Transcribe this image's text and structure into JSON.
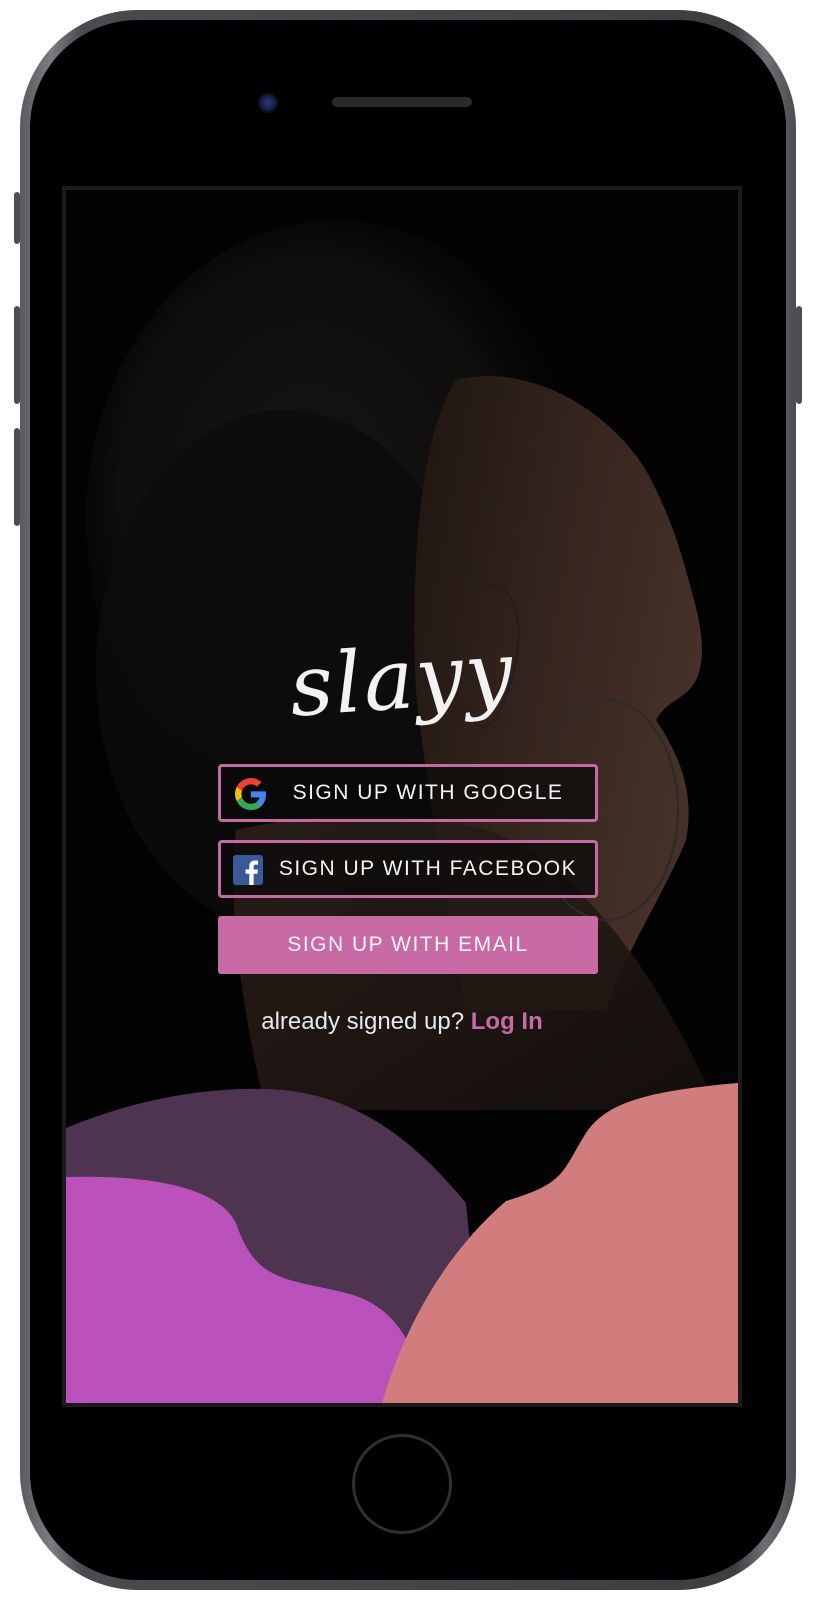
{
  "app": {
    "logo_text": "slayy"
  },
  "buttons": {
    "google_label": "SIGN UP WITH GOOGLE",
    "facebook_label": "SIGN UP WITH FACEBOOK",
    "email_label": "SIGN UP WITH EMAIL",
    "google_icon": "google-g-icon",
    "facebook_icon": "facebook-f-icon"
  },
  "login": {
    "prompt": "already signed up?",
    "link_label": "Log In"
  },
  "colors": {
    "accent": "#c86aa4",
    "wave_purple": "#4f3452",
    "wave_magenta": "#bb52bb",
    "wave_coral": "#d27d7d"
  }
}
